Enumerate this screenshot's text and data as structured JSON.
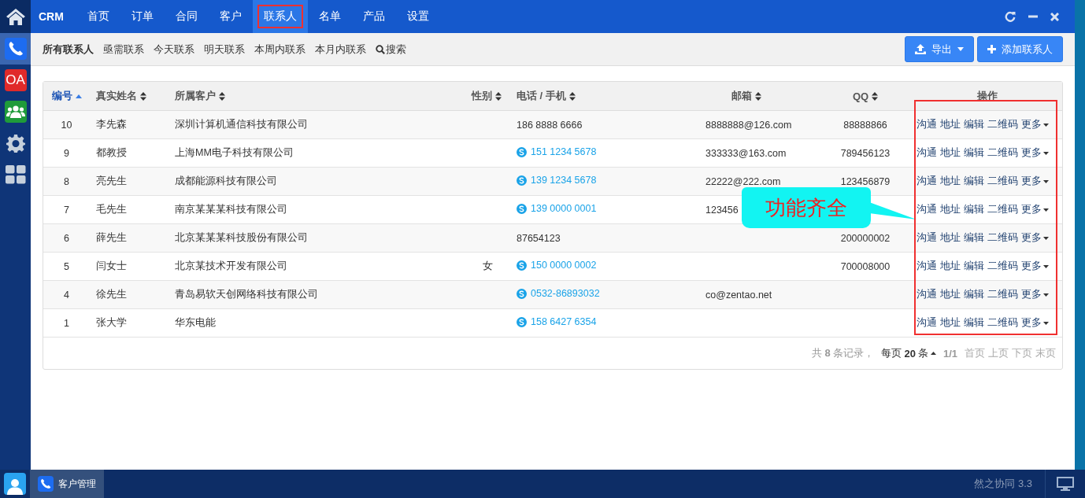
{
  "sidebar": {
    "apps": [
      {
        "kind": "phone",
        "selected": true
      },
      {
        "kind": "oa",
        "label": "OA",
        "selected": false
      },
      {
        "kind": "group",
        "selected": false
      },
      {
        "kind": "gear",
        "selected": false
      },
      {
        "kind": "grid",
        "selected": false
      }
    ]
  },
  "nav": {
    "brand": "CRM",
    "items": [
      {
        "label": "首页",
        "selected": false,
        "highlighted": false
      },
      {
        "label": "订单",
        "selected": false,
        "highlighted": false
      },
      {
        "label": "合同",
        "selected": false,
        "highlighted": false
      },
      {
        "label": "客户",
        "selected": false,
        "highlighted": false
      },
      {
        "label": "联系人",
        "selected": true,
        "highlighted": true
      },
      {
        "label": "名单",
        "selected": false,
        "highlighted": false
      },
      {
        "label": "产品",
        "selected": false,
        "highlighted": false
      },
      {
        "label": "设置",
        "selected": false,
        "highlighted": false
      }
    ]
  },
  "filters": [
    {
      "label": "所有联系人",
      "selected": true,
      "kind": "text"
    },
    {
      "label": "亟需联系",
      "selected": false,
      "kind": "text"
    },
    {
      "label": "今天联系",
      "selected": false,
      "kind": "text"
    },
    {
      "label": "明天联系",
      "selected": false,
      "kind": "text"
    },
    {
      "label": "本周内联系",
      "selected": false,
      "kind": "text"
    },
    {
      "label": "本月内联系",
      "selected": false,
      "kind": "text"
    },
    {
      "label": "搜索",
      "selected": false,
      "kind": "search"
    }
  ],
  "toolbar": {
    "buttons": [
      {
        "kind": "export",
        "label": "导出"
      },
      {
        "kind": "add",
        "label": "添加联系人"
      }
    ]
  },
  "table": {
    "actions_highlighted": true,
    "columns": [
      {
        "label": "编号",
        "sortable": true,
        "sorted_ascending": true
      },
      {
        "label": "真实姓名",
        "sortable": true,
        "sorted_ascending": false
      },
      {
        "label": "所属客户",
        "sortable": true,
        "sorted_ascending": false
      },
      {
        "label": "性别",
        "sortable": true,
        "sorted_ascending": false
      },
      {
        "label": "电话 / 手机",
        "sortable": true,
        "sorted_ascending": false
      },
      {
        "label": "邮箱",
        "sortable": true,
        "sorted_ascending": false
      },
      {
        "label": "QQ",
        "sortable": true,
        "sorted_ascending": false
      },
      {
        "label": "操作",
        "sortable": false,
        "sorted_ascending": false
      }
    ],
    "rows": [
      {
        "id": "10",
        "name": "李先森",
        "customer": "深圳计算机通信科技有限公司",
        "phone": {
          "kind": "plain",
          "text": "186 8888 6666"
        },
        "email": "8888888@126.com",
        "qq": "88888866",
        "actions": [
          "沟通",
          "地址",
          "编辑",
          "二维码",
          "更多"
        ]
      },
      {
        "id": "9",
        "name": "都教授",
        "customer": "上海MM电子科技有限公司",
        "phone": {
          "kind": "skype",
          "text": "151 1234 5678"
        },
        "email": "333333@163.com",
        "qq": "789456123",
        "actions": [
          "沟通",
          "地址",
          "编辑",
          "二维码",
          "更多"
        ]
      },
      {
        "id": "8",
        "name": "亮先生",
        "customer": "成都能源科技有限公司",
        "phone": {
          "kind": "skype",
          "text": "139 1234 5678"
        },
        "email": "22222@222.com",
        "qq": "123456879",
        "actions": [
          "沟通",
          "地址",
          "编辑",
          "二维码",
          "更多"
        ]
      },
      {
        "id": "7",
        "name": "毛先生",
        "customer": "南京某某某科技有限公司",
        "phone": {
          "kind": "skype",
          "text": "139 0000 0001"
        },
        "email": "123456",
        "actions": [
          "沟通",
          "地址",
          "编辑",
          "二维码",
          "更多"
        ]
      },
      {
        "id": "6",
        "name": "薛先生",
        "customer": "北京某某某科技股份有限公司",
        "phone": {
          "kind": "plain",
          "text": "87654123"
        },
        "qq": "200000002",
        "actions": [
          "沟通",
          "地址",
          "编辑",
          "二维码",
          "更多"
        ]
      },
      {
        "id": "5",
        "name": "闫女士",
        "customer": "北京某技术开发有限公司",
        "gender": "女",
        "phone": {
          "kind": "skype",
          "text": "150 0000 0002"
        },
        "qq": "700008000",
        "actions": [
          "沟通",
          "地址",
          "编辑",
          "二维码",
          "更多"
        ]
      },
      {
        "id": "4",
        "name": "徐先生",
        "customer": "青岛易软天创网络科技有限公司",
        "phone": {
          "kind": "skype",
          "text": "0532-86893032"
        },
        "email": "co@zentao.net",
        "actions": [
          "沟通",
          "地址",
          "编辑",
          "二维码",
          "更多"
        ]
      },
      {
        "id": "1",
        "name": "张大学",
        "customer": "华东电能",
        "phone": {
          "kind": "skype",
          "text": "158 6427 6354"
        },
        "actions": [
          "沟通",
          "地址",
          "编辑",
          "二维码",
          "更多"
        ]
      }
    ]
  },
  "pager": {
    "summary": "共 **8** 条记录，",
    "per_page": "每页 **20** 条",
    "page": "1/1",
    "links": [
      "首页",
      "上页",
      "下页",
      "末页"
    ]
  },
  "callout": {
    "text": "功能齐全"
  },
  "taskbar": {
    "task": "客户管理",
    "version": "然之协同 3.3"
  }
}
